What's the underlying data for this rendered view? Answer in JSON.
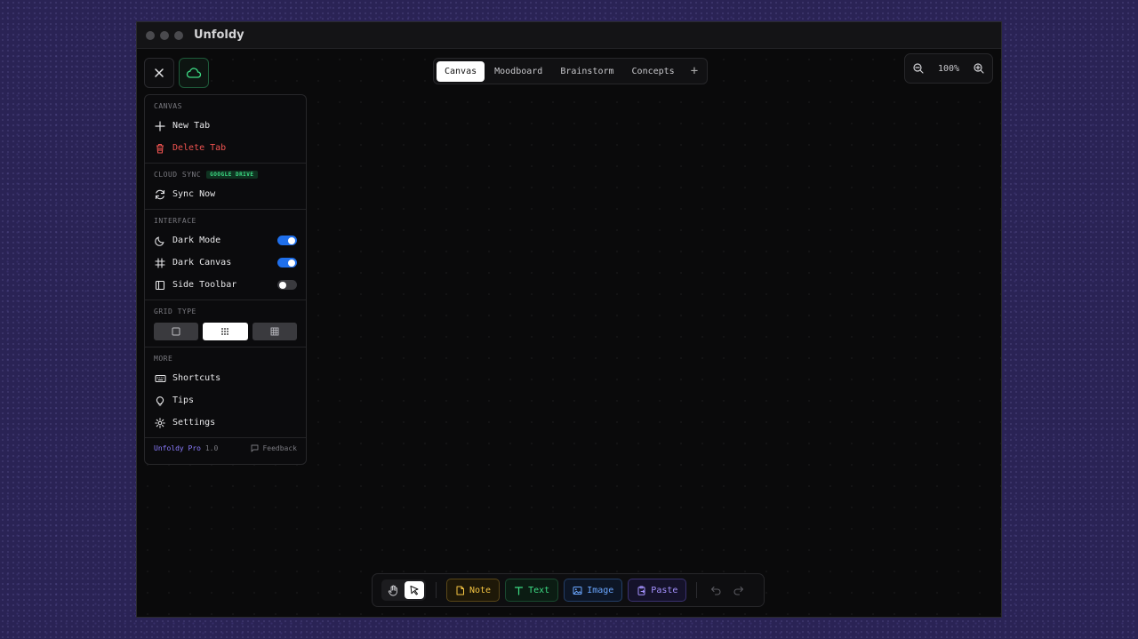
{
  "window": {
    "title": "Unfoldy"
  },
  "tabs": [
    {
      "label": "Canvas",
      "active": true
    },
    {
      "label": "Moodboard",
      "active": false
    },
    {
      "label": "Brainstorm",
      "active": false
    },
    {
      "label": "Concepts",
      "active": false
    }
  ],
  "tab_add_label": "+",
  "zoom": {
    "level": "100%"
  },
  "menu": {
    "canvas": {
      "title": "CANVAS",
      "new_tab": "New Tab",
      "delete_tab": "Delete Tab"
    },
    "cloud_sync": {
      "title": "CLOUD SYNC",
      "badge": "GOOGLE DRIVE",
      "sync_now": "Sync Now"
    },
    "interface": {
      "title": "INTERFACE",
      "dark_mode": "Dark Mode",
      "dark_mode_on": true,
      "dark_canvas": "Dark Canvas",
      "dark_canvas_on": true,
      "side_toolbar": "Side Toolbar",
      "side_toolbar_on": false
    },
    "grid_type": {
      "title": "GRID TYPE",
      "options": [
        "none",
        "dots",
        "lines"
      ],
      "selected": "dots"
    },
    "more": {
      "title": "MORE",
      "shortcuts": "Shortcuts",
      "tips": "Tips",
      "settings": "Settings"
    },
    "footer": {
      "brand": "Unfoldy Pro",
      "version": "1.0",
      "feedback": "Feedback"
    }
  },
  "toolbar": {
    "modes": [
      "hand",
      "select"
    ],
    "active_mode": "select",
    "note": "Note",
    "text": "Text",
    "image": "Image",
    "paste": "Paste"
  },
  "colors": {
    "background": "#2a2355",
    "window": "#0a0a0b",
    "accent_blue": "#1f6feb",
    "danger": "#ef5350",
    "note": "#f5c542",
    "text": "#3ddc84",
    "image": "#6aa6ff",
    "paste": "#a592ff",
    "brand": "#8b7cff"
  }
}
